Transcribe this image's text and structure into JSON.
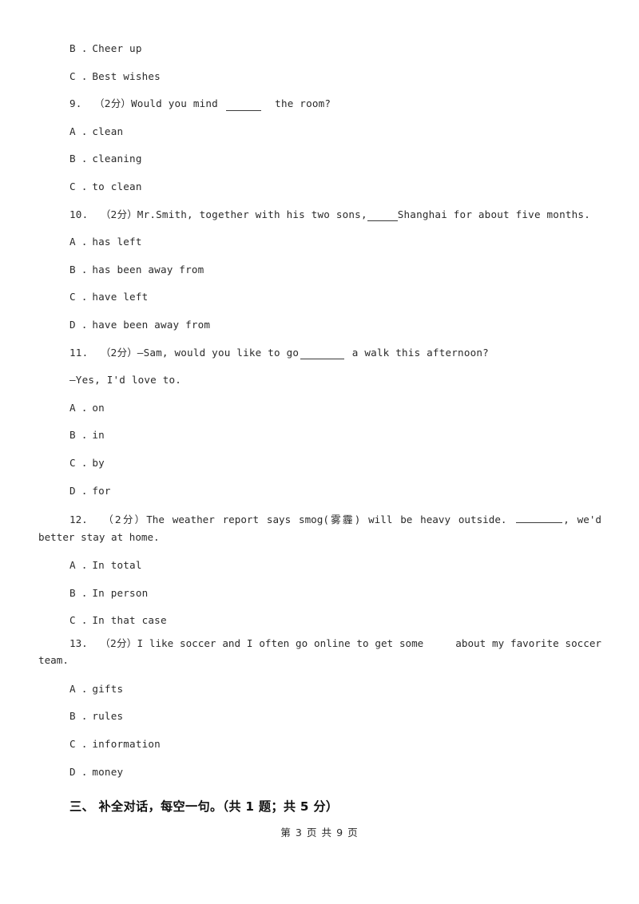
{
  "document": {
    "type": "english-exam-paper",
    "footer": "第 3 页 共 9 页"
  },
  "carryover_options": [
    {
      "label": "B ．Cheer up"
    },
    {
      "label": "C ．Best wishes"
    }
  ],
  "questions": [
    {
      "number": "9.",
      "marks": "（2分）",
      "stem_before": "Would you mind",
      "blank": "short",
      "stem_after": "the room?",
      "options": [
        "A ．clean",
        "B ．cleaning",
        "C ．to clean"
      ]
    },
    {
      "number": "10.",
      "marks": "（2分）",
      "stem_before": "Mr.Smith, together with his two sons,",
      "blank": "tight",
      "stem_after": "Shanghai for about five months.",
      "options": [
        "A ．has left",
        "B ．has been away from",
        "C ．have left",
        "D ．have been away from"
      ]
    },
    {
      "number": "11.",
      "marks": "（2分）",
      "stem_before": "—Sam, would you like to go",
      "blank": "mid",
      "stem_after": "a walk this afternoon?",
      "stem_line2": "—Yes, I'd love to.",
      "options": [
        "A ．on",
        "B ．in",
        "C ．by",
        "D ．for"
      ]
    },
    {
      "number": "12.",
      "marks": "（2分）",
      "paragraph_before": "The weather report says smog(雾霾) will be heavy outside. ",
      "blank": "long",
      "paragraph_after": ", we'd better stay at home.",
      "options": [
        "A ．In total",
        "B ．In person",
        "C ．In that case"
      ]
    },
    {
      "number": "13.",
      "marks": "（2分）",
      "paragraph_before": "I like soccer and I often go online to get some",
      "blank": "gap",
      "paragraph_after": "about my favorite soccer team.",
      "options": [
        "A ．gifts",
        "B ．rules",
        "C ．information",
        "D ．money"
      ]
    }
  ],
  "section_heading": {
    "number": "三、",
    "title": "补全对话，每空一句。",
    "scoring": "（共 1 题；共 5 分）",
    "full": "三、 补全对话，每空一句。（共 1 题；共 5 分）"
  }
}
